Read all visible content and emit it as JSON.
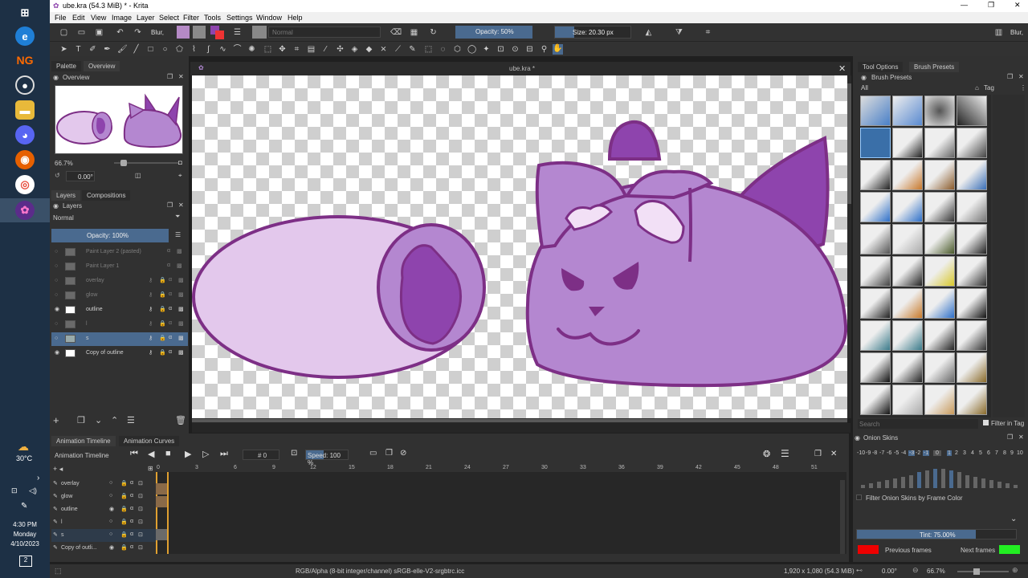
{
  "taskbar": {
    "weather": "30°C",
    "time": "4:30 PM",
    "day": "Monday",
    "date": "4/10/2023",
    "notify_count": "2"
  },
  "window": {
    "title": "ube.kra (54.3 MiB)  * - Krita"
  },
  "menu": [
    "File",
    "Edit",
    "View",
    "Image",
    "Layer",
    "Select",
    "Filter",
    "Tools",
    "Settings",
    "Window",
    "Help"
  ],
  "toolbar": {
    "brush_name": "Blur,",
    "blend_mode": "Normal",
    "opacity": "Opacity: 50%",
    "size": "Size: 20.30 px",
    "right_label": "Blur,"
  },
  "left_tabs": {
    "palette": "Palette",
    "overview": "Overview"
  },
  "overview": {
    "title": "Overview",
    "zoom": "66.7%",
    "rotation": "0.00°"
  },
  "layers_tabs": {
    "layers": "Layers",
    "compositions": "Compositions"
  },
  "layers": {
    "title": "Layers",
    "blend": "Normal",
    "opacity": "Opacity:  100%",
    "items": [
      {
        "name": "Paint Layer 2 (pasted)",
        "visible": false
      },
      {
        "name": "Paint Layer 1",
        "visible": false
      },
      {
        "name": "overlay",
        "visible": false
      },
      {
        "name": "glow",
        "visible": false
      },
      {
        "name": "outline",
        "visible": true
      },
      {
        "name": "l",
        "visible": false
      },
      {
        "name": "s",
        "visible": false
      },
      {
        "name": "Copy of outline",
        "visible": true
      }
    ]
  },
  "canvas": {
    "tab_title": "ube.kra *"
  },
  "right_tabs": {
    "tool_options": "Tool Options",
    "brush_presets": "Brush Presets"
  },
  "brush_presets": {
    "title": "Brush Presets",
    "filter": "All",
    "tag": "Tag",
    "search_placeholder": "Search",
    "filter_in_tag": "Filter in Tag"
  },
  "timeline_tabs": {
    "timeline": "Animation Timeline",
    "curves": "Animation Curves"
  },
  "timeline": {
    "title": "Animation Timeline",
    "frame": "0",
    "speed": "Speed: 100 %",
    "frame_numbers": [
      "0",
      "3",
      "6",
      "9",
      "12",
      "15",
      "18",
      "21",
      "24",
      "27",
      "30",
      "33",
      "36",
      "39",
      "42",
      "45",
      "48",
      "51"
    ],
    "rows": [
      "overlay",
      "glow",
      "outline",
      "l",
      "s",
      "Copy of outli..."
    ]
  },
  "onion": {
    "title": "Onion Skins",
    "numbers": [
      "-10",
      "-9",
      "-8",
      "-7",
      "-6",
      "-5",
      "-4",
      "-3",
      "-2",
      "-1",
      "0",
      "1",
      "2",
      "3",
      "4",
      "5",
      "6",
      "7",
      "8",
      "9",
      "10"
    ],
    "filter_label": "Filter Onion Skins by Frame Color",
    "tint": "Tint: 75.00%",
    "prev_label": "Previous frames",
    "next_label": "Next frames"
  },
  "status": {
    "color_info": "RGB/Alpha (8-bit integer/channel)  sRGB-elle-V2-srgbtrc.icc",
    "image_size": "1,920 x 1,080 (54.3 MiB)",
    "rotation": "0.00°",
    "zoom": "66.7%"
  },
  "colors": {
    "lavender": "#e3c8ec",
    "mid_purple": "#b487d0",
    "dark_purple": "#8e44ad",
    "outline": "#7d2f86",
    "selection": "#4a6a8f",
    "accent": "#4a6a8f"
  }
}
